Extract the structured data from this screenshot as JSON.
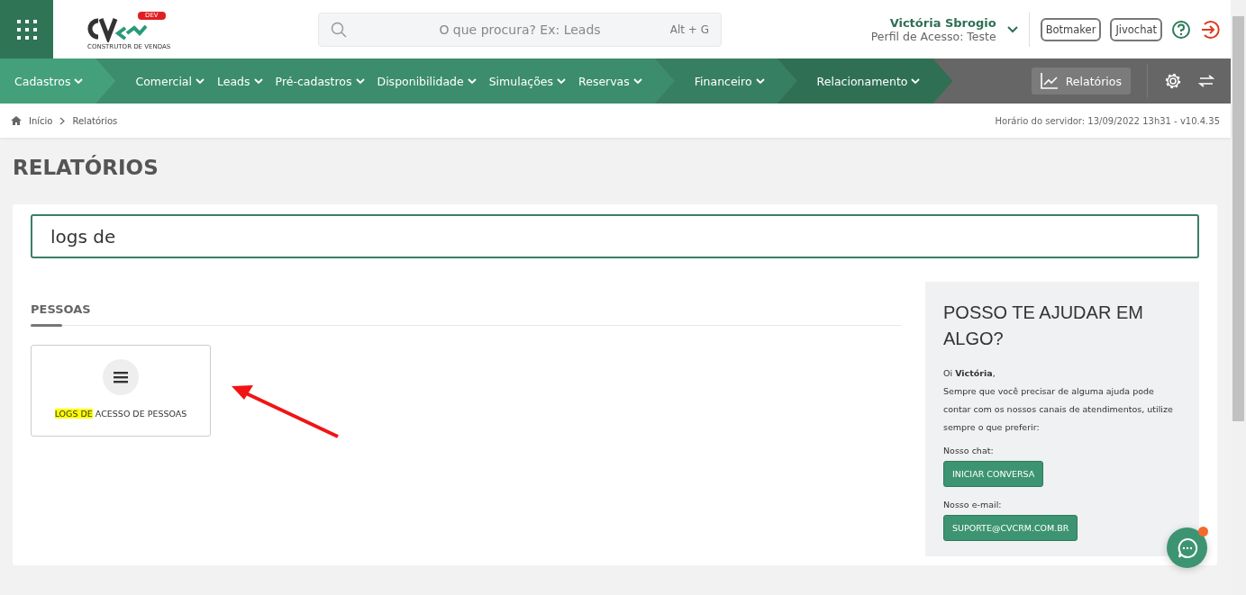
{
  "header": {
    "logo_badge": "DEV",
    "logo_tagline": "CONSTRUTOR DE VENDAS",
    "search": {
      "placeholder": "O que procura? Ex: Leads",
      "shortcut": "Alt + G"
    },
    "user": {
      "name": "Victória Sbrogio",
      "profile": "Perfil de Acesso: Teste"
    },
    "buttons": [
      "Botmaker",
      "Jivochat"
    ]
  },
  "nav": {
    "segments": [
      {
        "items": [
          "Cadastros"
        ]
      },
      {
        "items": [
          "Comercial",
          "Leads",
          "Pré-cadastros",
          "Disponibilidade",
          "Simulações",
          "Reservas"
        ]
      },
      {
        "items": [
          "Financeiro"
        ]
      },
      {
        "items": [
          "Relacionamento"
        ]
      }
    ],
    "reports_button": {
      "label": "Relatórios",
      "selected": true
    }
  },
  "breadcrumb": [
    "Início",
    "Relatórios"
  ],
  "server_time": "Horário do servidor: 13/09/2022 13h31 - v10.4.35",
  "page_title": "RELATÓRIOS",
  "search_value": "logs de",
  "section": {
    "title": "PESSOAS",
    "reports": [
      {
        "highlight": "LOGS DE",
        "rest": " ACESSO DE PESSOAS"
      }
    ]
  },
  "help": {
    "title": "POSSO TE AJUDAR EM ALGO?",
    "greeting": "Oi **Victória**,",
    "text": "Sempre que você precisar de alguma ajuda pode contar com os nossos canais de atendimentos, utilize sempre o que preferir:",
    "chat_label": "Nosso chat:",
    "chat_button": "INICIAR CONVERSA",
    "email_label": "Nosso e-mail:",
    "email_button": "SUPORTE@CVCRM.COM.BR"
  },
  "chat_widget": {
    "notification": true
  }
}
